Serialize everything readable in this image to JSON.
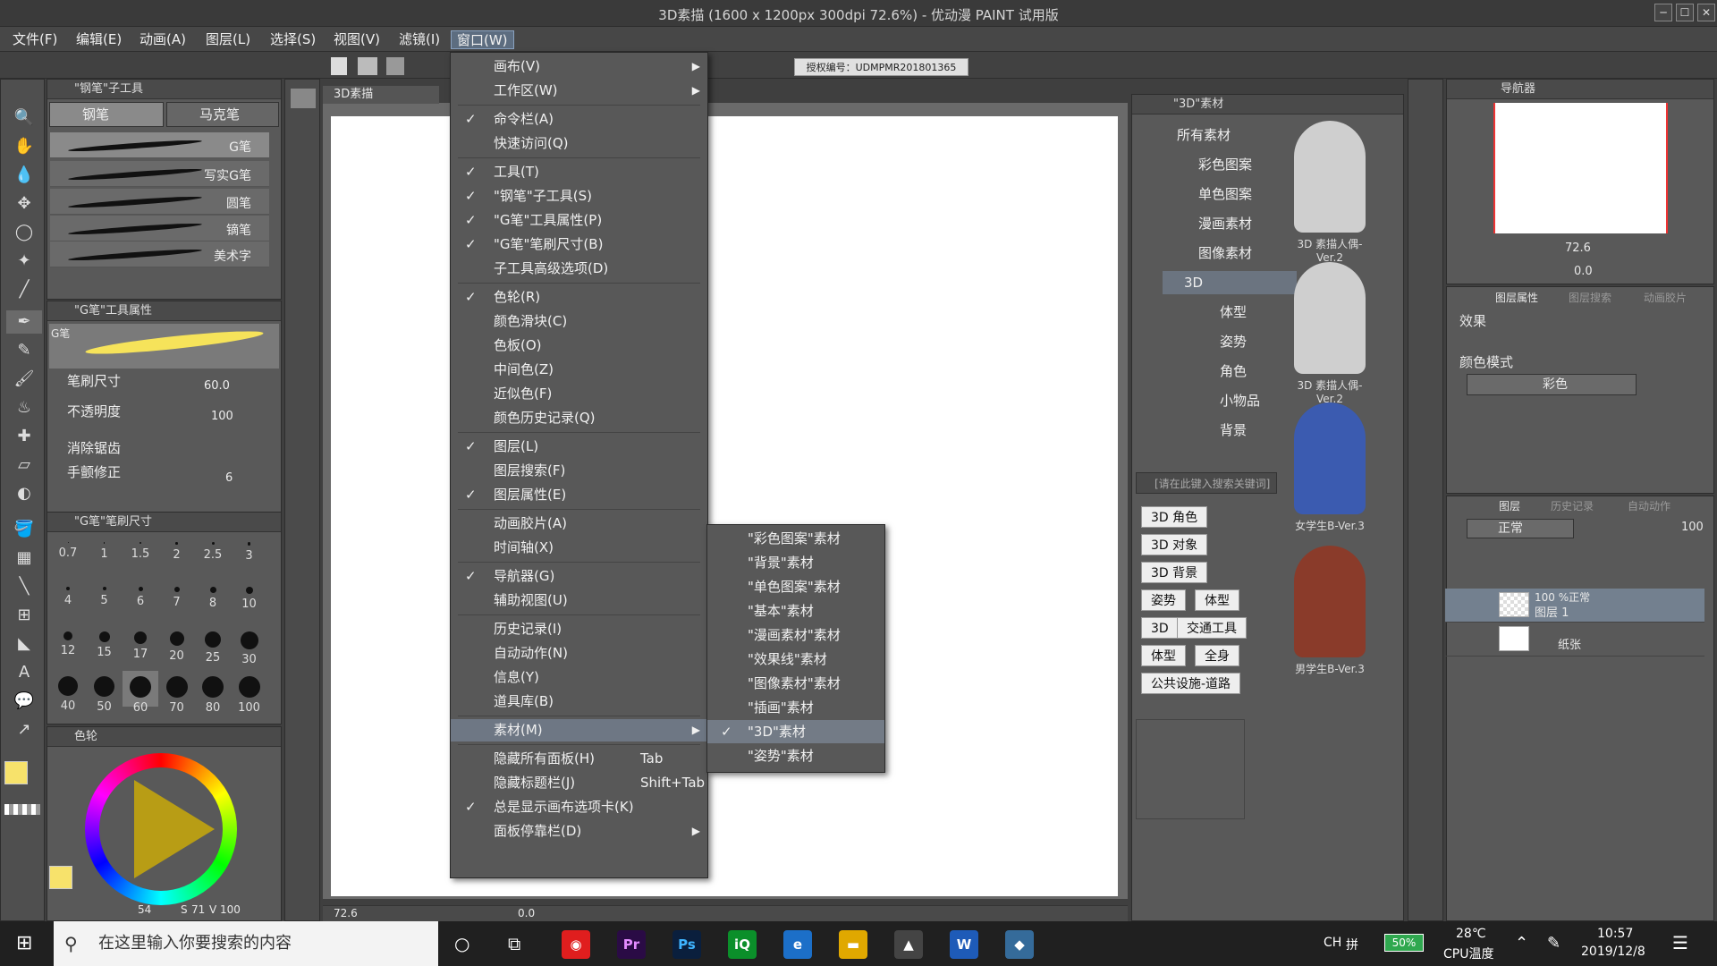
{
  "window": {
    "title": "3D素描 (1600 x 1200px 300dpi 72.6%) - 优动漫 PAINT 试用版",
    "min": "─",
    "max": "☐",
    "close": "✕"
  },
  "menubar": [
    "文件(F)",
    "编辑(E)",
    "动画(A)",
    "图层(L)",
    "选择(S)",
    "视图(V)",
    "滤镜(I)",
    "窗口(W)"
  ],
  "license": "授权编号：UDMPMR201801365",
  "subtool_panel": {
    "title": "\"钢笔\"子工具",
    "tabs": [
      "钢笔",
      "马克笔"
    ],
    "brushes": [
      "G笔",
      "写实G笔",
      "圆笔",
      "镝笔",
      "美术字"
    ]
  },
  "tool_property": {
    "title": "\"G笔\"工具属性",
    "preview_label": "G笔",
    "brush_size_label": "笔刷尺寸",
    "brush_size": "60.0",
    "opacity_label": "不透明度",
    "opacity": "100",
    "antialias_label": "消除锯齿",
    "stabilization_label": "手颤修正",
    "stabilization": "6"
  },
  "brush_size_panel": {
    "title": "\"G笔\"笔刷尺寸",
    "sizes": [
      "0.7",
      "1",
      "1.5",
      "2",
      "2.5",
      "3",
      "4",
      "5",
      "6",
      "7",
      "8",
      "10",
      "12",
      "15",
      "17",
      "20",
      "25",
      "30",
      "40",
      "50",
      "60",
      "70",
      "80",
      "100"
    ]
  },
  "color_panel": {
    "tab": "色轮",
    "hue": "54",
    "s_label": "S",
    "s": "71",
    "v_label": "V",
    "v": "100"
  },
  "canvas": {
    "tab": "3D素描",
    "zoom": "72.6",
    "rotate": "0.0"
  },
  "window_menu": {
    "items": [
      {
        "label": "画布(V)",
        "check": false,
        "arrow": true
      },
      {
        "label": "工作区(W)",
        "check": false,
        "arrow": true
      },
      {
        "label": "命令栏(A)",
        "check": true
      },
      {
        "label": "快速访问(Q)",
        "check": false
      },
      {
        "label": "工具(T)",
        "check": true
      },
      {
        "label": "\"钢笔\"子工具(S)",
        "check": true
      },
      {
        "label": "\"G笔\"工具属性(P)",
        "check": true
      },
      {
        "label": "\"G笔\"笔刷尺寸(B)",
        "check": true
      },
      {
        "label": "子工具高级选项(D)",
        "check": false
      },
      {
        "label": "色轮(R)",
        "check": true
      },
      {
        "label": "颜色滑块(C)",
        "check": false
      },
      {
        "label": "色板(O)",
        "check": false
      },
      {
        "label": "中间色(Z)",
        "check": false
      },
      {
        "label": "近似色(F)",
        "check": false
      },
      {
        "label": "颜色历史记录(Q)",
        "check": false
      },
      {
        "label": "图层(L)",
        "check": true
      },
      {
        "label": "图层搜索(F)",
        "check": false
      },
      {
        "label": "图层属性(E)",
        "check": true
      },
      {
        "label": "动画胶片(A)",
        "check": false
      },
      {
        "label": "时间轴(X)",
        "check": false
      },
      {
        "label": "导航器(G)",
        "check": true
      },
      {
        "label": "辅助视图(U)",
        "check": false
      },
      {
        "label": "历史记录(I)",
        "check": false
      },
      {
        "label": "自动动作(N)",
        "check": false
      },
      {
        "label": "信息(Y)",
        "check": false
      },
      {
        "label": "道具库(B)",
        "check": false
      },
      {
        "label": "素材(M)",
        "check": false,
        "arrow": true,
        "highlight": true
      },
      {
        "label": "隐藏所有面板(H)",
        "check": false,
        "shortcut": "Tab"
      },
      {
        "label": "隐藏标题栏(J)",
        "check": false,
        "shortcut": "Shift+Tab"
      },
      {
        "label": "总是显示画布选项卡(K)",
        "check": true
      },
      {
        "label": "面板停靠栏(D)",
        "check": false,
        "arrow": true
      }
    ],
    "check_glyph": "✓",
    "arrow_glyph": "▶"
  },
  "material_submenu": [
    {
      "label": "\"彩色图案\"素材",
      "check": false
    },
    {
      "label": "\"背景\"素材",
      "check": false
    },
    {
      "label": "\"单色图案\"素材",
      "check": false
    },
    {
      "label": "\"基本\"素材",
      "check": false
    },
    {
      "label": "\"漫画素材\"素材",
      "check": false
    },
    {
      "label": "\"效果线\"素材",
      "check": false
    },
    {
      "label": "\"图像素材\"素材",
      "check": false
    },
    {
      "label": "\"插画\"素材",
      "check": false
    },
    {
      "label": "\"3D\"素材",
      "check": true,
      "highlight": true
    },
    {
      "label": "\"姿势\"素材",
      "check": false
    }
  ],
  "material_panel": {
    "title": "\"3D\"素材",
    "tree": [
      "所有素材",
      "彩色图案",
      "单色图案",
      "漫画素材",
      "图像素材",
      "3D",
      "体型",
      "姿势",
      "角色",
      "小物品",
      "背景"
    ],
    "search_placeholder": "[请在此键入搜索关键词]",
    "tags": [
      "3D 角色",
      "3D 对象",
      "3D 背景",
      "姿势",
      "体型",
      "3D",
      "交通工具",
      "体型",
      "全身",
      "公共设施-道路"
    ],
    "thumbs": [
      "3D 素描人偶-Ver.2",
      "3D 素描人偶-Ver.2",
      "女学生B-Ver.3",
      "男学生B-Ver.3"
    ]
  },
  "navigator": {
    "title": "导航器",
    "zoom": "72.6",
    "rotate": "0.0"
  },
  "layer_property": {
    "tabs": [
      "图层属性",
      "图层搜索",
      "动画胶片"
    ],
    "effect_label": "效果",
    "color_mode_label": "颜色模式",
    "color_mode": "彩色"
  },
  "layers_panel": {
    "tabs": [
      "图层",
      "历史记录",
      "自动动作"
    ],
    "blend": "正常",
    "opacity": "100",
    "layers": [
      {
        "info": "100 %正常",
        "name": "图层 1"
      },
      {
        "info": "",
        "name": "纸张"
      }
    ]
  },
  "taskbar": {
    "search_placeholder": "在这里输入你要搜索的内容",
    "apps": [
      "网易云",
      "Pr",
      "Ps",
      "iQIYI",
      "Edge",
      "资源管理器",
      "照片",
      "W",
      "优动漫"
    ],
    "ime": "CH",
    "battery": "50%",
    "temp": "28℃",
    "temp_label": "CPU温度",
    "time": "10:57",
    "date": "2019/12/8"
  }
}
